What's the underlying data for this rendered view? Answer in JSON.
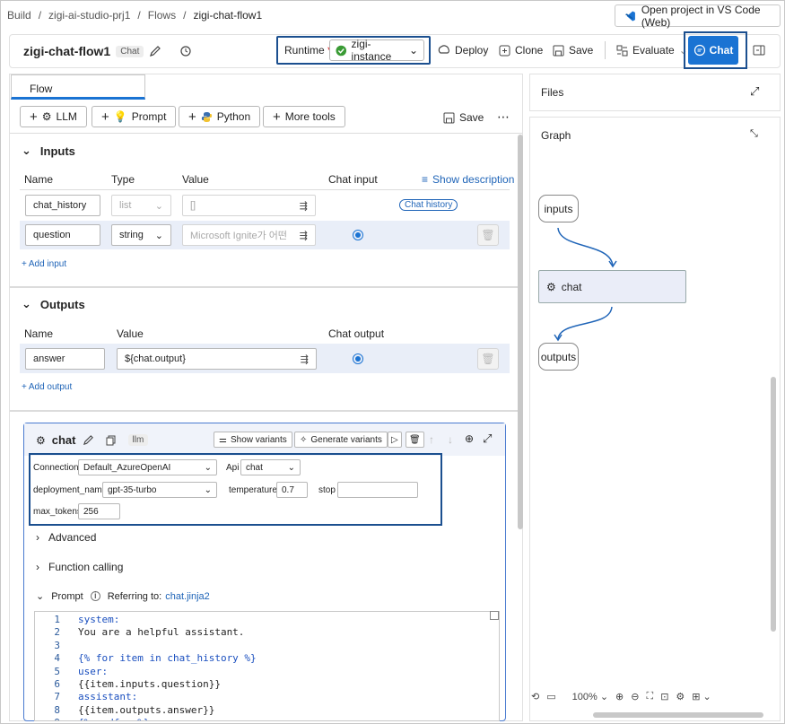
{
  "breadcrumb": [
    "Build",
    "zigi-ai-studio-prj1",
    "Flows",
    "zigi-chat-flow1"
  ],
  "vscode_button": "Open project in VS Code (Web)",
  "flow": {
    "name": "zigi-chat-flow1",
    "badge": "Chat"
  },
  "runtime": {
    "label": "Runtime",
    "required_mark": "*",
    "value": "zigi-instance"
  },
  "toolbar": {
    "deploy": "Deploy",
    "clone": "Clone",
    "save": "Save",
    "evaluate": "Evaluate",
    "chat": "Chat"
  },
  "tab": "Flow",
  "tools": {
    "llm": "LLM",
    "prompt": "Prompt",
    "python": "Python",
    "more": "More tools",
    "save": "Save"
  },
  "inputs": {
    "title": "Inputs",
    "headers": {
      "name": "Name",
      "type": "Type",
      "value": "Value",
      "chat_input": "Chat input"
    },
    "show_description": "Show description",
    "rows": [
      {
        "name": "chat_history",
        "type": "list",
        "value": "[]",
        "tag": "Chat history"
      },
      {
        "name": "question",
        "type": "string",
        "value": "Microsoft Ignite가 어떤"
      }
    ],
    "add": "Add input"
  },
  "outputs": {
    "title": "Outputs",
    "headers": {
      "name": "Name",
      "value": "Value",
      "chat_output": "Chat output"
    },
    "rows": [
      {
        "name": "answer",
        "value": "${chat.output}"
      }
    ],
    "add": "Add output"
  },
  "node": {
    "name": "chat",
    "type_badge": "llm",
    "show_variants": "Show variants",
    "generate_variants": "Generate variants",
    "connection_label": "Connection",
    "connection": "Default_AzureOpenAI",
    "api_label": "Api",
    "api": "chat",
    "deployment_label": "deployment_name",
    "deployment": "gpt-35-turbo",
    "temperature_label": "temperature",
    "temperature": "0.7",
    "stop_label": "stop",
    "stop": "",
    "max_tokens_label": "max_tokens",
    "max_tokens": "256",
    "advanced": "Advanced",
    "function_calling": "Function calling",
    "prompt_label": "Prompt",
    "referring": "Referring to:",
    "prompt_file": "chat.jinja2"
  },
  "code_lines": [
    {
      "n": "1",
      "t": "system:"
    },
    {
      "n": "2",
      "t": "You are a helpful assistant."
    },
    {
      "n": "3",
      "t": ""
    },
    {
      "n": "4",
      "t": "{% for item in chat_history %}"
    },
    {
      "n": "5",
      "t": "user:"
    },
    {
      "n": "6",
      "t": "{{item.inputs.question}}"
    },
    {
      "n": "7",
      "t": "assistant:"
    },
    {
      "n": "8",
      "t": "{{item.outputs.answer}}"
    },
    {
      "n": "9",
      "t": "{% endfor %}"
    }
  ],
  "files_title": "Files",
  "graph": {
    "title": "Graph",
    "nodes": [
      "inputs",
      "chat",
      "outputs"
    ],
    "zoom": "100%"
  },
  "colors": {
    "accent": "#1a73d3",
    "highlight_border": "#1b4f8f",
    "success": "#3a9b35"
  }
}
